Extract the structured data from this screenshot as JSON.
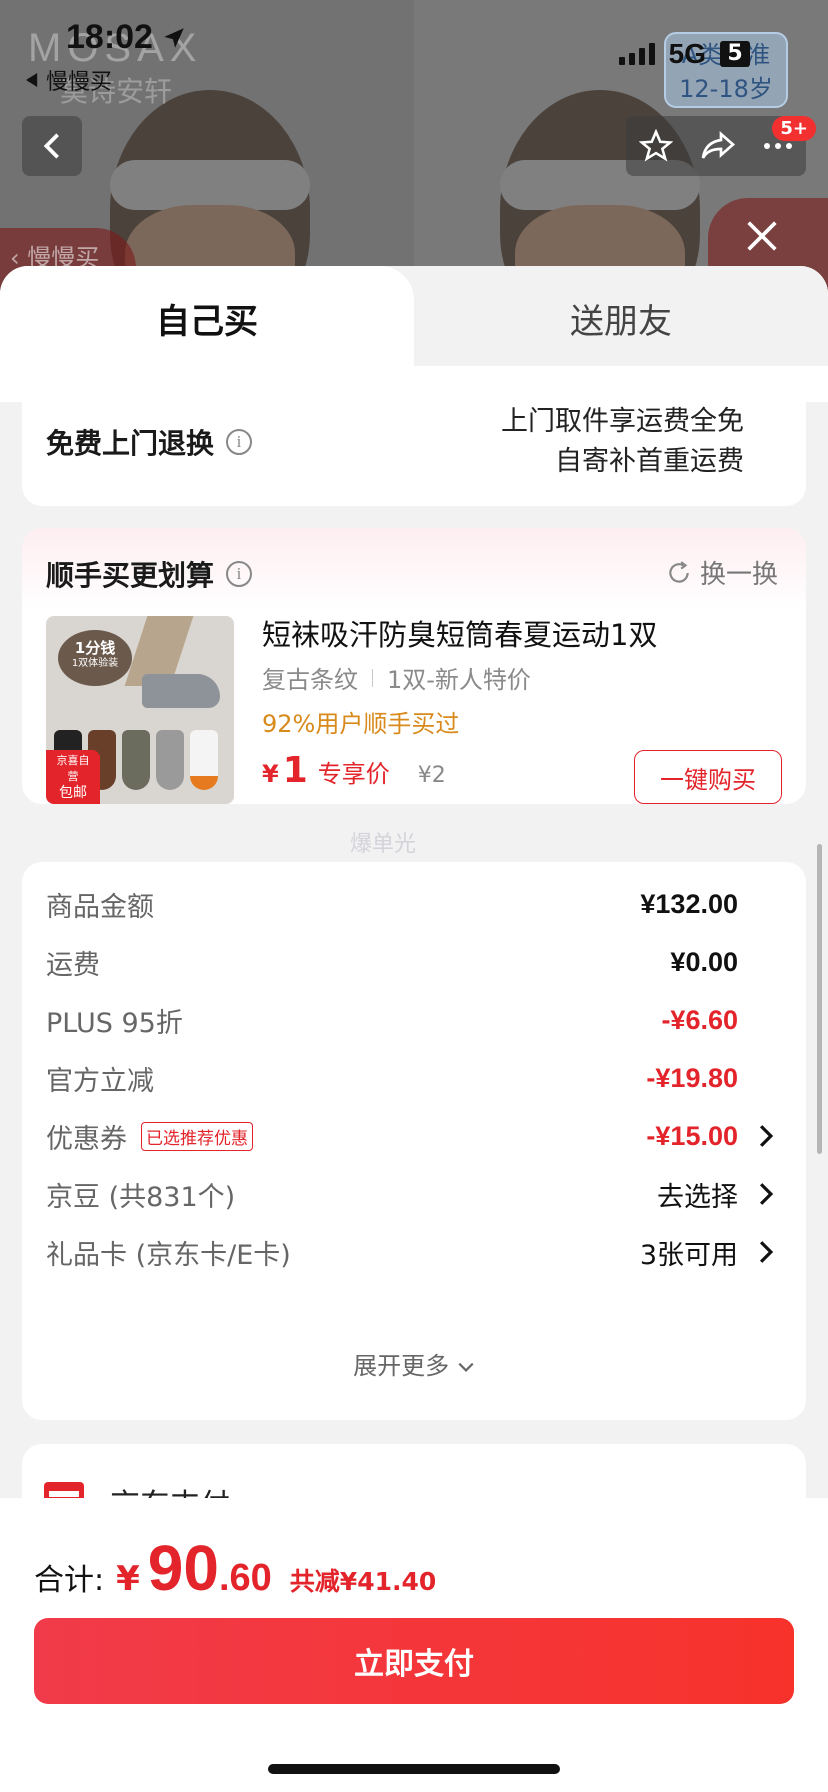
{
  "status_bar": {
    "time": "18:02",
    "back_app": "慢慢买",
    "network": "5G",
    "network_box": "5"
  },
  "background_page": {
    "brand": "MOSAX",
    "brand_sub": "莫诗安轩",
    "std_badge_line1": "A类标准",
    "std_badge_line2": "12-18岁",
    "cart_count": "5+",
    "side_tag": "慢慢买"
  },
  "tabs": {
    "self": "自己买",
    "friend": "送朋友"
  },
  "return_service": {
    "title": "免费上门退换",
    "line1": "上门取件享运费全免",
    "line2": "自寄补首重运费"
  },
  "recommendation": {
    "title": "顺手买更划算",
    "swap": "换一换",
    "img_badge_line1": "1分钱",
    "img_badge_line2": "1双体验装",
    "img_tag_line1": "京喜自营",
    "img_tag_line2": "包邮",
    "name": "短袜吸汗防臭短筒春夏运动1双",
    "spec1": "复古条纹",
    "spec2": "1双-新人特价",
    "rate": "92%用户顺手买过",
    "price_symbol": "¥",
    "price": "1",
    "price_label": "专享价",
    "orig_price": "¥2",
    "buy": "一键购买"
  },
  "watermark": "爆单光",
  "costs": {
    "goods_label": "商品金额",
    "goods_value": "¥132.00",
    "shipping_label": "运费",
    "shipping_value": "¥0.00",
    "plus_label": "PLUS 95折",
    "plus_value": "-¥6.60",
    "official_label": "官方立减",
    "official_value": "-¥19.80",
    "coupon_label": "优惠券",
    "coupon_pill": "已选推荐优惠",
    "coupon_value": "-¥15.00",
    "jingdou_label": "京豆 (共831个)",
    "jingdou_value": "去选择",
    "giftcard_label": "礼品卡 (京东卡/E卡)",
    "giftcard_value": "3张可用",
    "expand": "展开更多"
  },
  "payment": {
    "label": "京东支付"
  },
  "bottom": {
    "total_label": "合计:",
    "total_yen": "¥",
    "total_int": "90",
    "total_dec": ".60",
    "total_saved": "共减¥41.40",
    "pay_button": "立即支付"
  },
  "colors": {
    "accent": "#e3242b",
    "rate": "#d88a1b"
  }
}
